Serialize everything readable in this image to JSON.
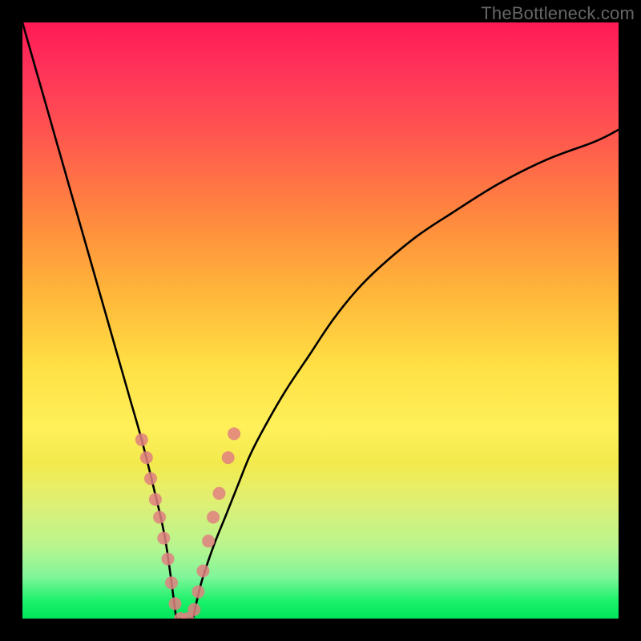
{
  "watermark": "TheBottleneck.com",
  "chart_data": {
    "type": "line",
    "title": "",
    "xlabel": "",
    "ylabel": "",
    "xlim": [
      0,
      100
    ],
    "ylim": [
      0,
      100
    ],
    "series": [
      {
        "name": "left-branch",
        "x": [
          0,
          2,
          4,
          6,
          8,
          10,
          12,
          14,
          16,
          18,
          20,
          22,
          24,
          25.8
        ],
        "y": [
          100,
          93,
          86,
          79,
          72,
          65,
          58,
          51,
          44,
          37,
          30,
          22,
          13,
          0
        ]
      },
      {
        "name": "right-branch",
        "x": [
          28.6,
          30,
          32,
          34,
          36,
          38,
          40,
          44,
          48,
          52,
          56,
          60,
          66,
          72,
          80,
          88,
          96,
          100
        ],
        "y": [
          0,
          6,
          12,
          17,
          22,
          27,
          31,
          38,
          44,
          50,
          55,
          59,
          64,
          68,
          73,
          77,
          80,
          82
        ]
      }
    ],
    "flat_bottom": {
      "x": [
        25.8,
        28.6
      ],
      "y": [
        0,
        0
      ]
    },
    "markers": {
      "name": "data-points",
      "color": "#e08080",
      "points": [
        {
          "x": 20.0,
          "y": 30.0
        },
        {
          "x": 20.8,
          "y": 27.0
        },
        {
          "x": 21.5,
          "y": 23.5
        },
        {
          "x": 22.3,
          "y": 20.0
        },
        {
          "x": 23.0,
          "y": 17.0
        },
        {
          "x": 23.7,
          "y": 13.5
        },
        {
          "x": 24.4,
          "y": 10.0
        },
        {
          "x": 25.0,
          "y": 6.0
        },
        {
          "x": 25.6,
          "y": 2.5
        },
        {
          "x": 26.5,
          "y": 0.0
        },
        {
          "x": 27.7,
          "y": 0.0
        },
        {
          "x": 28.8,
          "y": 1.5
        },
        {
          "x": 29.5,
          "y": 4.5
        },
        {
          "x": 30.3,
          "y": 8.0
        },
        {
          "x": 31.2,
          "y": 13.0
        },
        {
          "x": 32.0,
          "y": 17.0
        },
        {
          "x": 33.0,
          "y": 21.0
        },
        {
          "x": 34.5,
          "y": 27.0
        },
        {
          "x": 35.5,
          "y": 31.0
        }
      ]
    },
    "gradient_stops": [
      {
        "pos": 0,
        "color": "#ff1a54"
      },
      {
        "pos": 8,
        "color": "#ff335a"
      },
      {
        "pos": 20,
        "color": "#ff5a4e"
      },
      {
        "pos": 33,
        "color": "#ff8a3e"
      },
      {
        "pos": 46,
        "color": "#ffb83a"
      },
      {
        "pos": 58,
        "color": "#ffe145"
      },
      {
        "pos": 68,
        "color": "#fff05a"
      },
      {
        "pos": 74,
        "color": "#f2ea4d"
      },
      {
        "pos": 78,
        "color": "#e8ee66"
      },
      {
        "pos": 82,
        "color": "#d7f07a"
      },
      {
        "pos": 88,
        "color": "#b8f58f"
      },
      {
        "pos": 93,
        "color": "#80f59a"
      },
      {
        "pos": 97,
        "color": "#1cf26a"
      },
      {
        "pos": 100,
        "color": "#00e45a"
      }
    ]
  }
}
